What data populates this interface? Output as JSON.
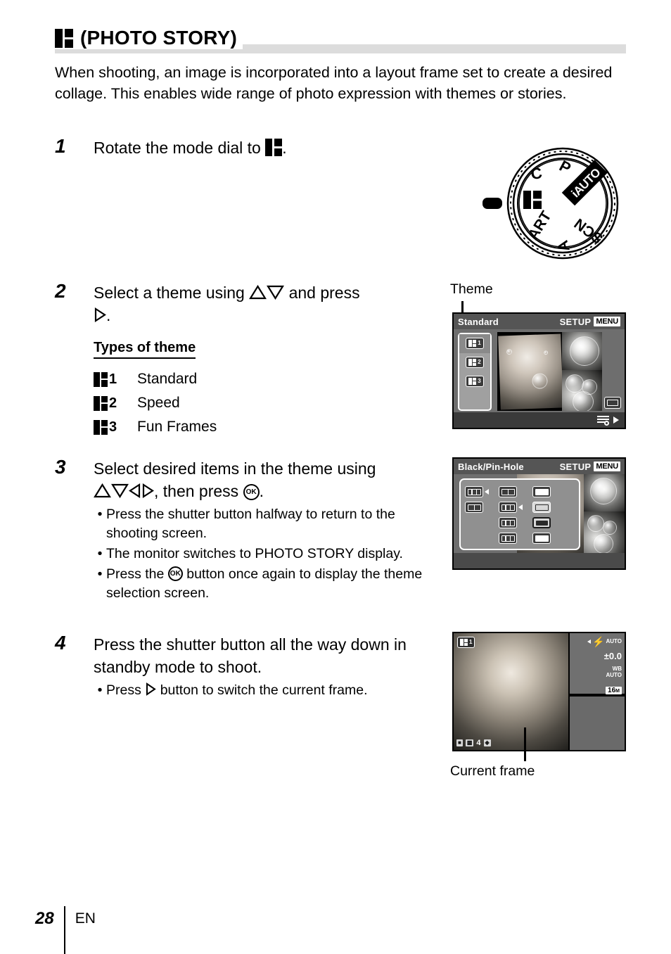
{
  "header": {
    "icon": "photo-story-icon",
    "title": "(PHOTO STORY)"
  },
  "intro": "When shooting, an image is incorporated into a layout frame set to create a desired collage. This enables wide range of photo expression with themes or stories.",
  "steps": [
    {
      "number": "1",
      "text_before": "Rotate the mode dial to",
      "text_after": "."
    },
    {
      "number": "2",
      "text_1": "Select a theme using",
      "text_2": "and press",
      "text_3": "."
    },
    {
      "number": "3",
      "text_1": "Select desired items in the theme using",
      "text_2": ", then press",
      "text_3": ".",
      "bullets": [
        "Press the shutter button halfway to return to the shooting screen.",
        "The monitor switches to PHOTO STORY display.",
        "Press the ⒪ button once again to display the theme selection screen."
      ],
      "bullet3_before": "Press the",
      "bullet3_after": "button once again to display the theme selection screen."
    },
    {
      "number": "4",
      "text": "Press the shutter button all the way down in standby mode to shoot.",
      "bullet_before": "Press",
      "bullet_after": "button to switch the current frame."
    }
  ],
  "types_of_theme": {
    "heading": "Types of theme",
    "items": [
      {
        "number": "1",
        "label": "Standard"
      },
      {
        "number": "2",
        "label": "Speed"
      },
      {
        "number": "3",
        "label": "Fun Frames"
      }
    ]
  },
  "callouts": {
    "theme": "Theme",
    "current_frame": "Current frame"
  },
  "screens": {
    "theme_select": {
      "title": "Standard",
      "setup_label": "SETUP",
      "menu_label": "MENU",
      "rail_items": [
        {
          "number": "1",
          "selected": true
        },
        {
          "number": "2",
          "selected": false
        },
        {
          "number": "3",
          "selected": false
        }
      ]
    },
    "item_select": {
      "title": "Black/Pin-Hole",
      "setup_label": "SETUP",
      "menu_label": "MENU"
    },
    "shooting": {
      "flash": "AUTO",
      "exposure": "±0.0",
      "wb_label": "WB",
      "wb_value": "AUTO",
      "image_size": "16",
      "image_size_unit": "M",
      "frame_count": "4",
      "theme_badge": "1"
    }
  },
  "mode_dial": {
    "labels": [
      "C",
      "P",
      "iAUTO",
      "SCN",
      "A",
      "ART"
    ],
    "photo_story": "photo-story-icon"
  },
  "footer": {
    "page": "28",
    "language": "EN"
  },
  "colors": {
    "rule": "#dcdcdc",
    "screen_bg": "#6e6e6e",
    "title_bar": "#555555"
  }
}
